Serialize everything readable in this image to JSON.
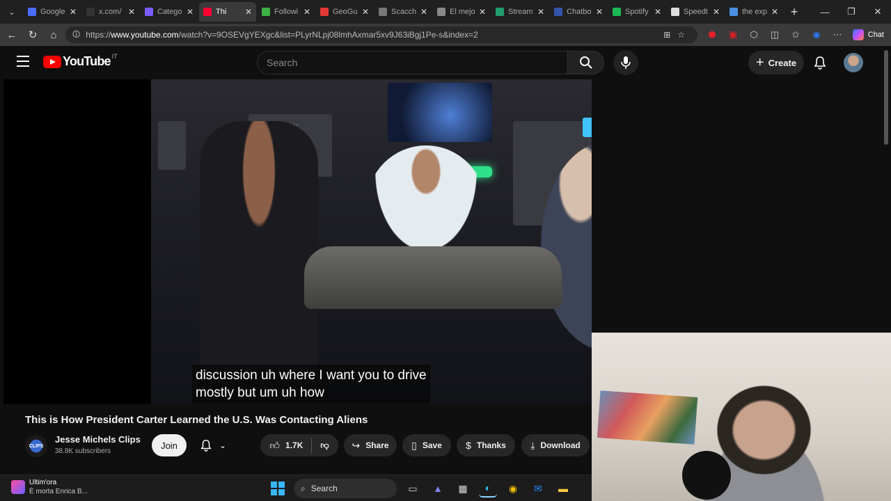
{
  "browser": {
    "tabs": [
      {
        "label": "Google",
        "color": "#4a6cf7",
        "active": false
      },
      {
        "label": "x.com/",
        "color": "#333333",
        "active": false
      },
      {
        "label": "Catego",
        "color": "#7a5cff",
        "active": false
      },
      {
        "label": "Thi",
        "color": "#ff0033",
        "active": true
      },
      {
        "label": "Followi",
        "color": "#3cb043",
        "active": false
      },
      {
        "label": "GeoGu",
        "color": "#e53935",
        "active": false
      },
      {
        "label": "Scacch",
        "color": "#777777",
        "active": false
      },
      {
        "label": "El mejo",
        "color": "#888888",
        "active": false
      },
      {
        "label": "Stream",
        "color": "#1f9e6e",
        "active": false
      },
      {
        "label": "Chatbo",
        "color": "#3355aa",
        "active": false
      },
      {
        "label": "Spotify",
        "color": "#1db954",
        "active": false
      },
      {
        "label": "Speedt",
        "color": "#dddddd",
        "active": false
      },
      {
        "label": "the exp",
        "color": "#4a90e2",
        "active": false
      }
    ],
    "url_prefix": "https://",
    "url_host": "www.youtube.com",
    "url_path": "/watch?v=9OSEVgYEXgc&list=PLyrNLpj08lmhAxmar5xv9J63iBgj1Pe-s&index=2",
    "copilot_label": "Chat"
  },
  "youtube": {
    "logo_text": "YouTube",
    "country_code": "IT",
    "search_placeholder": "Search",
    "create_label": "Create",
    "caption_line1": "discussion uh where I want you to drive",
    "caption_line2": "mostly but um uh how",
    "video_title": "This is How President Carter Learned the U.S. Was Contacting Aliens",
    "channel_name": "Jesse Michels Clips",
    "channel_subs": "38.8K subscribers",
    "channel_avatar_text": "CLIPS",
    "join_label": "Join",
    "like_count": "1.7K",
    "share_label": "Share",
    "save_label": "Save",
    "thanks_label": "Thanks",
    "download_label": "Download"
  },
  "taskbar": {
    "news_line1": "Ultim'ora",
    "news_line2": "È morta Enrica B...",
    "search_label": "Search"
  }
}
